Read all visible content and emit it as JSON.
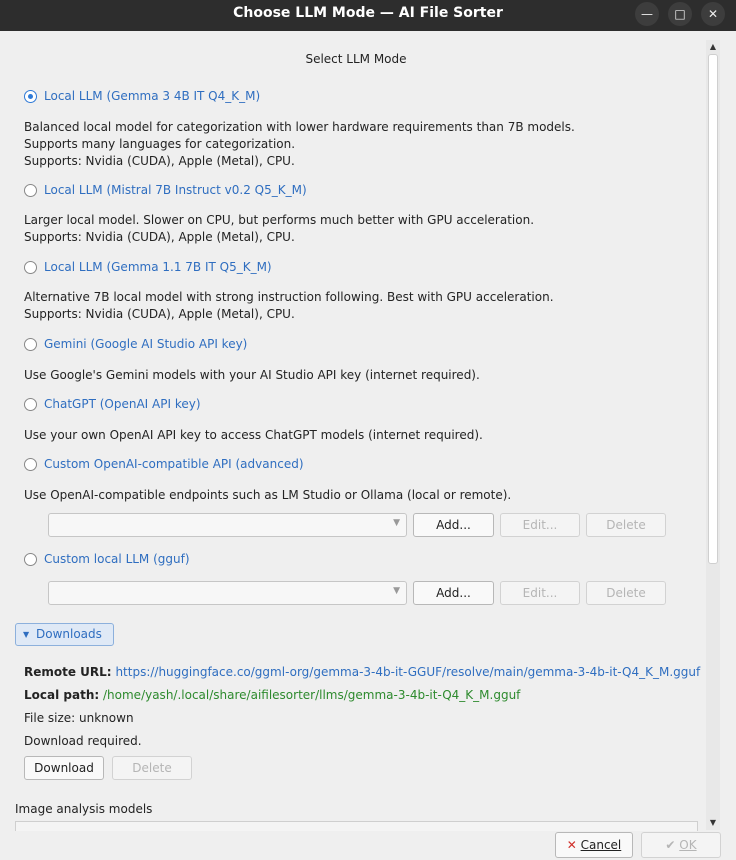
{
  "window": {
    "title": "Choose LLM Mode — AI File Sorter",
    "minimize_icon": "minimize-icon",
    "maximize_icon": "maximize-icon",
    "close_icon": "close-icon"
  },
  "header": {
    "title": "Select LLM Mode"
  },
  "options": [
    {
      "label": "Local LLM (Gemma 3 4B IT Q4_K_M)",
      "selected": true,
      "desc": [
        "Balanced local model for categorization with lower hardware requirements than 7B models.",
        "Supports many languages for categorization.",
        "Supports: Nvidia (CUDA), Apple (Metal), CPU."
      ]
    },
    {
      "label": "Local LLM (Mistral 7B Instruct v0.2 Q5_K_M)",
      "selected": false,
      "desc": [
        "Larger local model. Slower on CPU, but performs much better with GPU acceleration.",
        "Supports: Nvidia (CUDA), Apple (Metal), CPU."
      ]
    },
    {
      "label": "Local LLM (Gemma 1.1 7B IT Q5_K_M)",
      "selected": false,
      "desc": [
        "Alternative 7B local model with strong instruction following. Best with GPU acceleration.",
        "Supports: Nvidia (CUDA), Apple (Metal), CPU."
      ]
    },
    {
      "label": "Gemini (Google AI Studio API key)",
      "selected": false,
      "desc": [
        "Use Google's Gemini models with your AI Studio API key (internet required)."
      ]
    },
    {
      "label": "ChatGPT (OpenAI API key)",
      "selected": false,
      "desc": [
        "Use your own OpenAI API key to access ChatGPT models (internet required)."
      ]
    },
    {
      "label": "Custom OpenAI-compatible API (advanced)",
      "selected": false,
      "desc": [
        "Use OpenAI-compatible endpoints such as LM Studio or Ollama (local or remote)."
      ]
    },
    {
      "label": "Custom local LLM (gguf)",
      "selected": false,
      "desc": []
    }
  ],
  "custom_api_row": {
    "add": "Add...",
    "edit": "Edit...",
    "delete": "Delete"
  },
  "custom_local_row": {
    "add": "Add...",
    "edit": "Edit...",
    "delete": "Delete"
  },
  "downloads": {
    "toggle_label": "Downloads",
    "remote_url_label": "Remote URL:",
    "remote_url": "https://huggingface.co/ggml-org/gemma-3-4b-it-GGUF/resolve/main/gemma-3-4b-it-Q4_K_M.gguf",
    "local_path_label": "Local path:",
    "local_path": "/home/yash/.local/share/aifilesorter/llms/gemma-3-4b-it-Q4_K_M.gguf",
    "file_size": "File size: unknown",
    "status": "Download required.",
    "download_button": "Download",
    "delete_button": "Delete"
  },
  "image_analysis": {
    "title": "Image analysis models"
  },
  "footer": {
    "cancel": "Cancel",
    "ok": "OK"
  },
  "colors": {
    "accent": "#2f6ec0",
    "path_green": "#2d8a2d"
  }
}
